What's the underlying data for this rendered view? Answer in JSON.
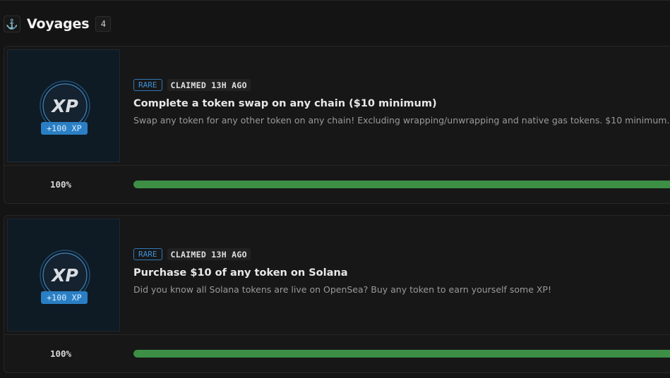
{
  "section": {
    "title": "Voyages",
    "count": "4",
    "icon": "anchor-icon"
  },
  "quests": [
    {
      "rarity": "RARE",
      "claimed": "CLAIMED 13H AGO",
      "title": "Complete a token swap on any chain ($10 minimum)",
      "description": "Swap any token for any other token on any chain! Excluding wrapping/unwrapping and native gas tokens. $10 minimum.",
      "xp_logo": "XP",
      "xp_reward": "+100 XP",
      "progress_label": "100%",
      "progress": 1.0
    },
    {
      "rarity": "RARE",
      "claimed": "CLAIMED 13H AGO",
      "title": "Purchase $10 of any token on Solana",
      "description": "Did you know all Solana tokens are live on OpenSea? Buy any token to earn yourself some XP!",
      "xp_logo": "XP",
      "xp_reward": "+100 XP",
      "progress_label": "100%",
      "progress": 1.0
    }
  ],
  "colors": {
    "rare": "#3b8fd6",
    "progress": "#3c8f45",
    "xp_badge": "#2a7fc4"
  }
}
